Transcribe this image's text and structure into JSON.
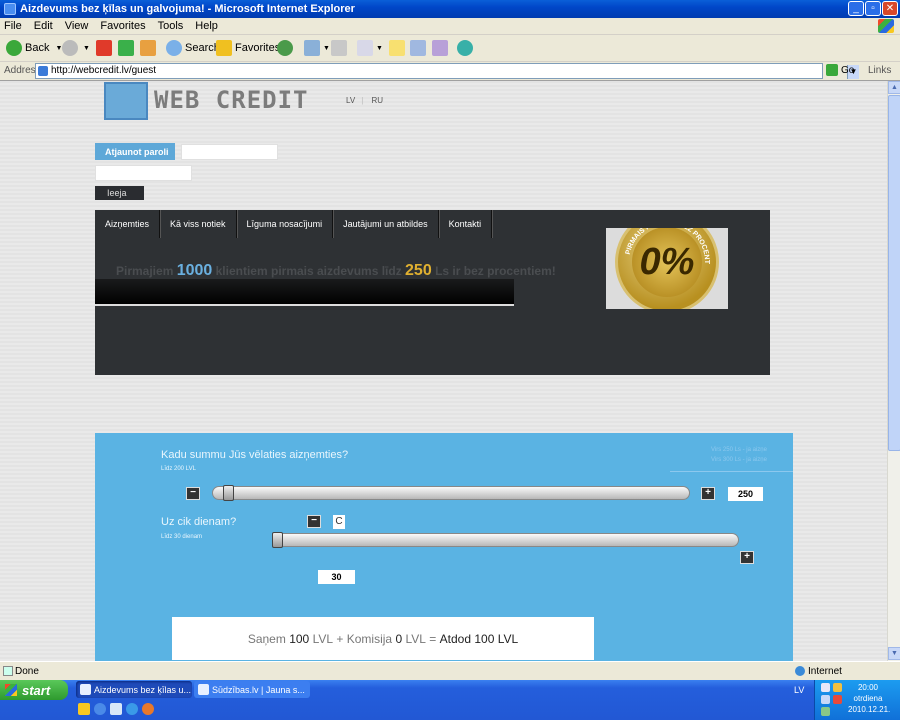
{
  "window": {
    "title": "Aizdevums bez ķīlas un galvojuma! - Microsoft Internet Explorer"
  },
  "menu": [
    "File",
    "Edit",
    "View",
    "Favorites",
    "Tools",
    "Help"
  ],
  "toolbar": {
    "back": "Back",
    "search": "Search",
    "favorites": "Favorites"
  },
  "address": {
    "label": "Address",
    "url": "http://webcredit.lv/guest",
    "go": "Go",
    "links": "Links"
  },
  "site": {
    "logo_text": "WEB CREDIT",
    "lang": [
      "LV",
      "RU"
    ],
    "login": {
      "reset_label": "Atjaunot paroli",
      "login_label": "Ieeja"
    },
    "nav": [
      "Aizņemties",
      "Kā viss notiek",
      "Līguma nosacījumi",
      "Jautājumi un atbildes",
      "Kontakti"
    ],
    "promo": {
      "part1": "Pirmajiem ",
      "num1": "1000",
      "part2": " klientiem pirmais aizdevums līdz ",
      "num2": "250",
      "part3": " Ls ir bez procentiem!"
    },
    "badge": {
      "ring_text": "PIRMAIS KREDĪTS BEZ PROCENTIEM",
      "percent": "0%"
    }
  },
  "calculator": {
    "amount_question": "Kadu summu Jūs vēlaties aizņemties?",
    "amount_sub": "Līdz 200 LVL",
    "info_lines": [
      "Virs 250 Ls - ja aizņe",
      "Virs 300 Ls - ja aizņe"
    ],
    "amount_value": "250",
    "days_question": "Uz cik dienam?",
    "days_sub": "Līdz 30 dienam",
    "days_knob": "C",
    "days_value": "30",
    "amount_slider_fraction": 0.02,
    "days_slider_fraction": 0.0,
    "summary": {
      "get_label": "Saņem",
      "get_amount": "100",
      "unit": "LVL",
      "plus": "+",
      "fee_label": "Komisija",
      "fee_amount": "0",
      "eq": "=",
      "return_text": "Atdod 100 LVL"
    }
  },
  "status": {
    "text": "Done",
    "zone": "Internet"
  },
  "taskbar": {
    "start": "start",
    "tasks": [
      "Aizdevums bez ķīlas u...",
      "Sūdzības.lv | Jauna s..."
    ],
    "lang": "LV",
    "clock_time": "20:00",
    "clock_day": "otrdiena",
    "clock_date": "2010.12.21."
  }
}
